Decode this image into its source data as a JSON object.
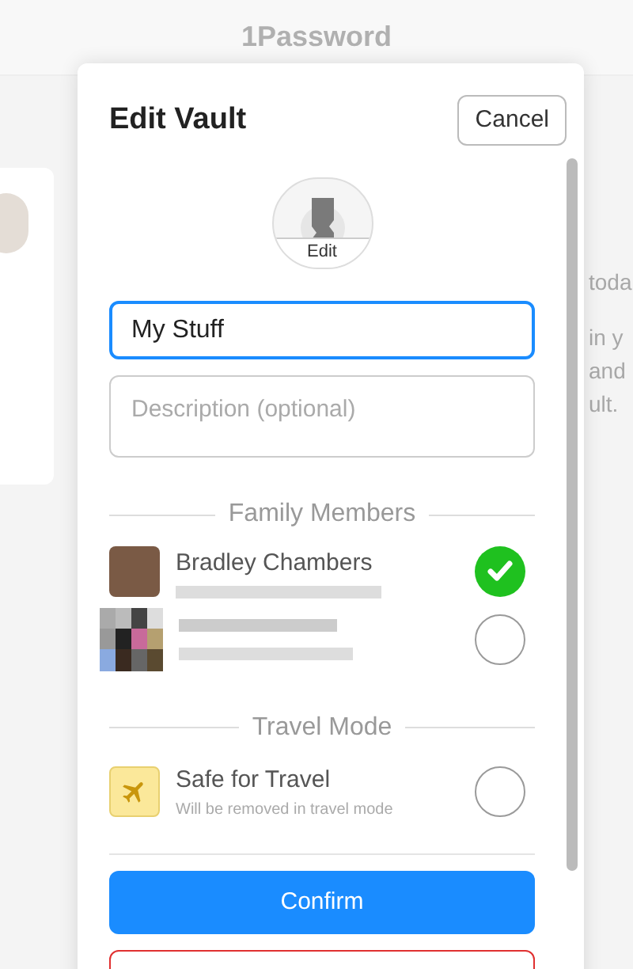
{
  "app": {
    "title": "1Password",
    "background_texts": [
      "toda",
      "in y",
      "and",
      "ult."
    ]
  },
  "dialog": {
    "title": "Edit Vault",
    "cancel": "Cancel",
    "icon_label": "Edit",
    "name_field": {
      "value": "My Stuff"
    },
    "description_field": {
      "placeholder": "Description (optional)"
    },
    "members_heading": "Family Members",
    "members": [
      {
        "name": "Bradley Chambers",
        "selected": true,
        "kind": "photo"
      },
      {
        "selected": false,
        "kind": "pixelated"
      }
    ],
    "travel_heading": "Travel Mode",
    "travel": {
      "title": "Safe for Travel",
      "subtitle": "Will be removed in travel mode",
      "selected": false
    },
    "confirm": "Confirm"
  }
}
